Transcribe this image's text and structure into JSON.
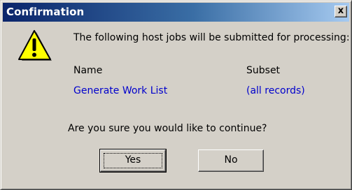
{
  "dialog": {
    "title": "Confirmation",
    "close_glyph": "x",
    "icon": "warning-icon",
    "message": "The following host jobs will be submitted for processing:",
    "table": {
      "headers": [
        "Name",
        "Subset"
      ],
      "rows": [
        [
          "Generate Work List",
          "(all records)"
        ]
      ]
    },
    "question": "Are you sure you would like to continue?",
    "buttons": {
      "yes": "Yes",
      "no": "No"
    },
    "colors": {
      "title_bar_start": "#0a246a",
      "title_bar_end": "#a6caf0",
      "face": "#d4d0c8",
      "link_text": "#0000cc",
      "warning_fill": "#ffff00"
    }
  }
}
